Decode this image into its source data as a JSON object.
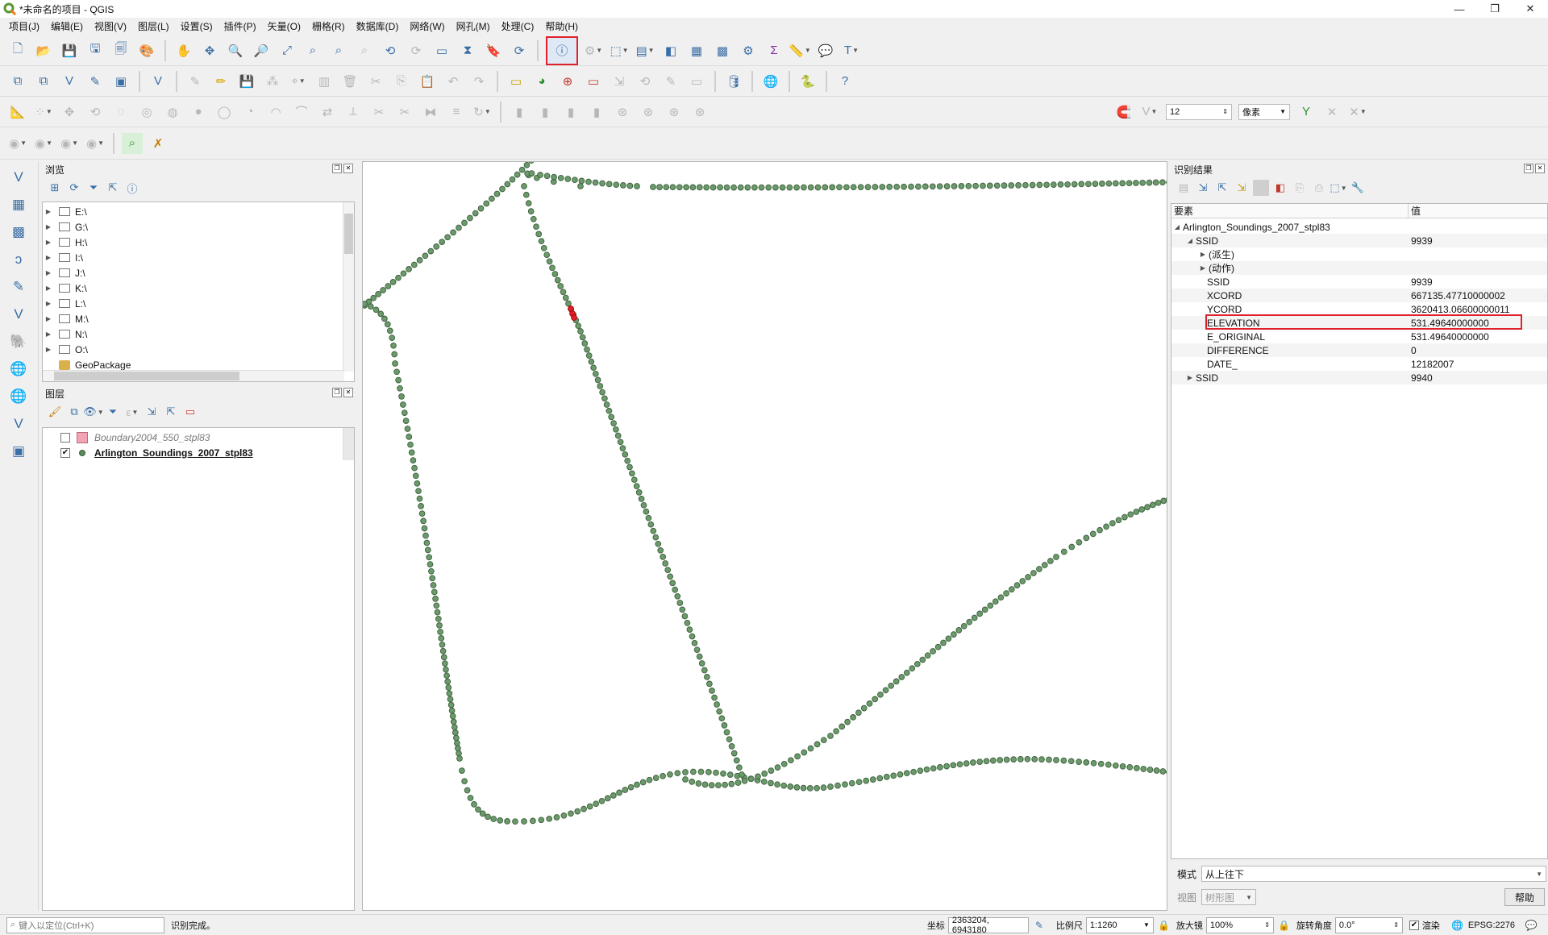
{
  "window": {
    "title": "*未命名的项目 - QGIS",
    "controls": [
      "—",
      "❐",
      "✕"
    ]
  },
  "menus": [
    "项目(J)",
    "编辑(E)",
    "视图(V)",
    "图层(L)",
    "设置(S)",
    "插件(P)",
    "矢量(O)",
    "栅格(R)",
    "数据库(D)",
    "网络(W)",
    "网孔(M)",
    "处理(C)",
    "帮助(H)"
  ],
  "snapping": {
    "tolerance": "12",
    "unit": "像素"
  },
  "browser": {
    "title": "浏览",
    "items": [
      "E:\\",
      "G:\\",
      "H:\\",
      "I:\\",
      "J:\\",
      "K:\\",
      "L:\\",
      "M:\\",
      "N:\\",
      "O:\\"
    ],
    "gpkg": "GeoPackage"
  },
  "layers": {
    "title": "图层",
    "items": [
      {
        "name": "Boundary2004_550_stpl83",
        "checked": false
      },
      {
        "name": "Arlington_Soundings_2007_stpl83",
        "checked": true
      }
    ]
  },
  "identify": {
    "title": "识别结果",
    "col_feature": "要素",
    "col_value": "值",
    "layer": "Arlington_Soundings_2007_stpl83",
    "feature_label": "SSID",
    "feature_value": "9939",
    "derived": "(派生)",
    "actions": "(动作)",
    "attributes": [
      {
        "name": "SSID",
        "value": "9939"
      },
      {
        "name": "XCORD",
        "value": "667135.47710000002"
      },
      {
        "name": "YCORD",
        "value": "3620413.06600000011"
      },
      {
        "name": "ELEVATION",
        "value": "531.49640000000"
      },
      {
        "name": "E_ORIGINAL",
        "value": "531.49640000000"
      },
      {
        "name": "DIFFERENCE",
        "value": "0"
      },
      {
        "name": "DATE_",
        "value": "12182007"
      }
    ],
    "next_label": "SSID",
    "next_value": "9940",
    "mode_label": "模式",
    "mode_value": "从上往下",
    "view_label": "视图",
    "view_value": "树形图",
    "help": "帮助"
  },
  "status": {
    "locator_placeholder": "键入以定位(Ctrl+K)",
    "message": "识别完成。",
    "coord_label": "坐标",
    "coord": "2363204, 6943180",
    "scale_label": "比例尺",
    "scale": "1:1260",
    "magnifier_label": "放大镜",
    "magnifier": "100%",
    "rotation_label": "旋转角度",
    "rotation": "0.0°",
    "render_label": "渲染",
    "crs": "EPSG:2276"
  },
  "colors": {
    "point_fill": "#6b9a6b",
    "point_stroke": "#3d5f3d",
    "selected": "#e0202a",
    "accent": "#e0202a"
  }
}
